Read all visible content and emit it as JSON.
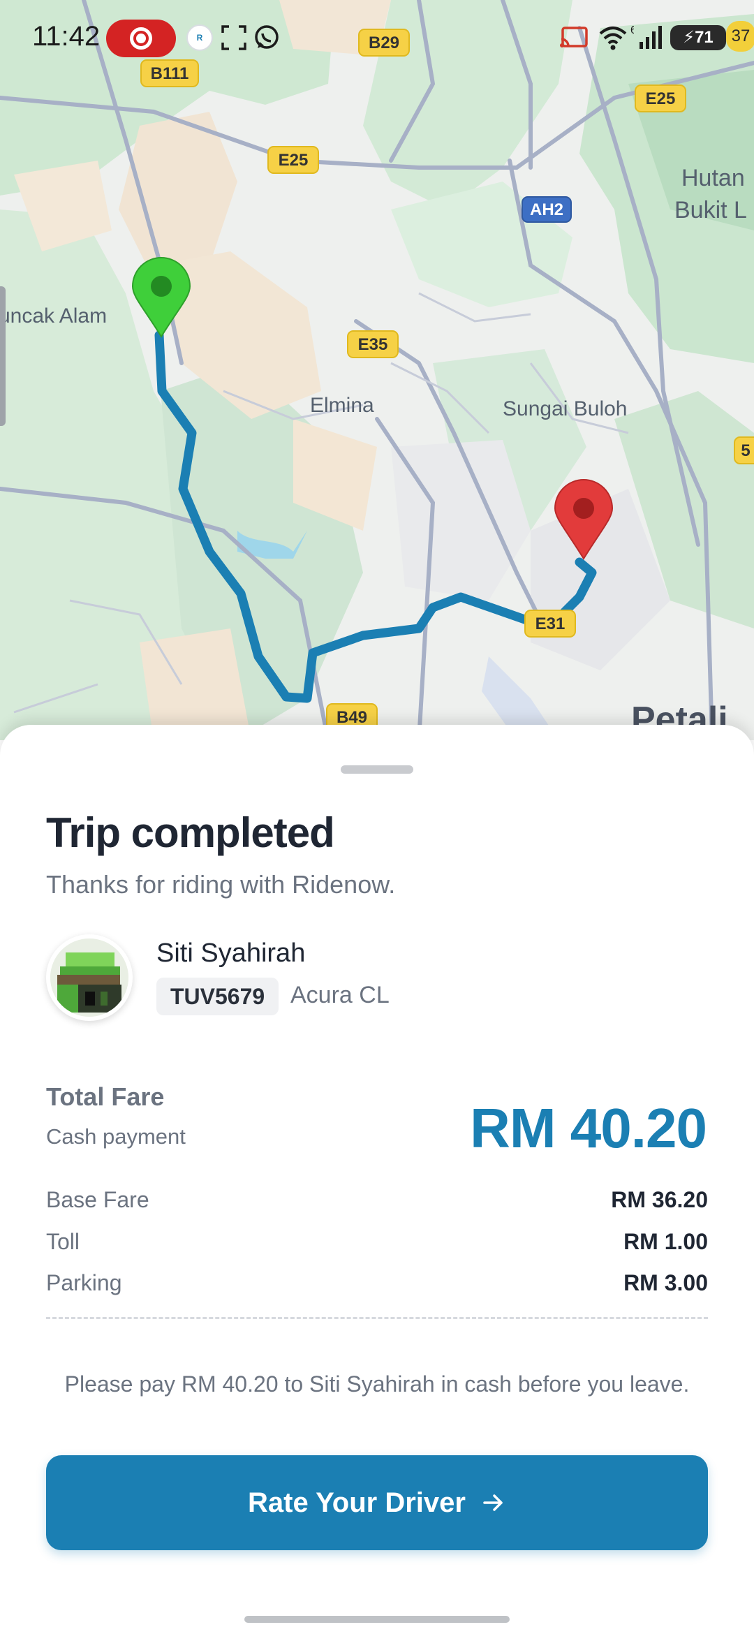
{
  "status_bar": {
    "time": "11:42",
    "battery": "71",
    "battery_extra": "37",
    "wifi_badge": "6",
    "icons": [
      "screen-record-icon",
      "ridenow-app-icon",
      "screenshot-icon",
      "whatsapp-icon",
      "cast-icon",
      "wifi-icon",
      "signal-icon",
      "battery-icon"
    ]
  },
  "map": {
    "labels": [
      "uncak Alam",
      "Elmina",
      "Sungai Buloh",
      "Hutan",
      "Bukit L",
      "Petali"
    ],
    "road_shields": [
      "B111",
      "B29",
      "E25",
      "E25",
      "AH2",
      "E35",
      "E31",
      "B49",
      "5"
    ],
    "colors": {
      "route": "#1b7fb3",
      "pickup_pin": "#3fcf3a",
      "dropoff_pin": "#e23b3b"
    }
  },
  "trip": {
    "title": "Trip completed",
    "subtitle": "Thanks for riding with Ridenow."
  },
  "driver": {
    "name": "Siti Syahirah",
    "plate": "TUV5679",
    "car": "Acura CL"
  },
  "fare": {
    "total_label": "Total Fare",
    "payment_method": "Cash payment",
    "total_amount": "RM 40.20",
    "items": [
      {
        "label": "Base Fare",
        "value": "RM 36.20"
      },
      {
        "label": "Toll",
        "value": "RM 1.00"
      },
      {
        "label": "Parking",
        "value": "RM 3.00"
      }
    ]
  },
  "note": "Please pay RM 40.20 to Siti Syahirah in cash before you leave.",
  "actions": {
    "rate_label": "Rate Your Driver",
    "rate_icon": "arrow-right-icon"
  }
}
